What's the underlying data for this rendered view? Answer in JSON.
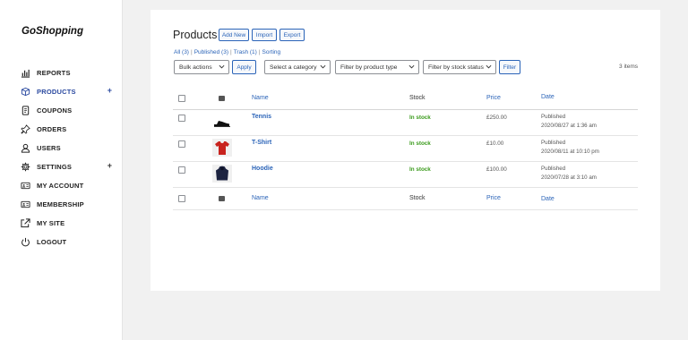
{
  "brand": "GoShopping",
  "sidebar": {
    "items": [
      {
        "label": "REPORTS",
        "icon": "bar-chart-icon",
        "active": false,
        "plus": ""
      },
      {
        "label": "PRODUCTS",
        "icon": "box-icon",
        "active": true,
        "plus": "+"
      },
      {
        "label": "COUPONS",
        "icon": "coupon-icon",
        "active": false,
        "plus": ""
      },
      {
        "label": "ORDERS",
        "icon": "pin-icon",
        "active": false,
        "plus": ""
      },
      {
        "label": "USERS",
        "icon": "user-icon",
        "active": false,
        "plus": ""
      },
      {
        "label": "SETTINGS",
        "icon": "gear-icon",
        "active": false,
        "plus": "+"
      },
      {
        "label": "MY ACCOUNT",
        "icon": "id-card-icon",
        "active": false,
        "plus": ""
      },
      {
        "label": "MEMBERSHIP",
        "icon": "id-card-icon",
        "active": false,
        "plus": ""
      },
      {
        "label": "MY SITE",
        "icon": "external-link-icon",
        "active": false,
        "plus": ""
      },
      {
        "label": "LOGOUT",
        "icon": "power-icon",
        "active": false,
        "plus": ""
      }
    ]
  },
  "page": {
    "title": "Products",
    "add_new": "Add New",
    "import": "Import",
    "export": "Export"
  },
  "filters_links": {
    "all": "All (3)",
    "published": "Published (3)",
    "trash": "Trash (1)",
    "sorting": "Sorting",
    "sep": "|"
  },
  "toolbar": {
    "bulk_actions": "Bulk actions",
    "apply": "Apply",
    "category": "Select a category",
    "product_type": "Filter by product type",
    "stock_status": "Filter by stock status",
    "filter": "Filter",
    "count": "3 items"
  },
  "table": {
    "headers": {
      "name": "Name",
      "stock": "Stock",
      "price": "Price",
      "date": "Date"
    },
    "rows": [
      {
        "name": "Tennis",
        "stock": "In stock",
        "price": "£250.00",
        "status": "Published",
        "date": "2020/08/27 at 1:36 am",
        "thumb": "shoe"
      },
      {
        "name": "T-Shirt",
        "stock": "In stock",
        "price": "£10.00",
        "status": "Published",
        "date": "2020/08/11 at 10:10 pm",
        "thumb": "tshirt"
      },
      {
        "name": "Hoodie",
        "stock": "In stock",
        "price": "£100.00",
        "status": "Published",
        "date": "2020/07/28 at 3:10 am",
        "thumb": "hoodie"
      }
    ]
  },
  "colors": {
    "accent": "#2b64b8",
    "in_stock": "#3a9a1b",
    "active_nav": "#2b4aa0",
    "background": "#f1f1f1"
  }
}
